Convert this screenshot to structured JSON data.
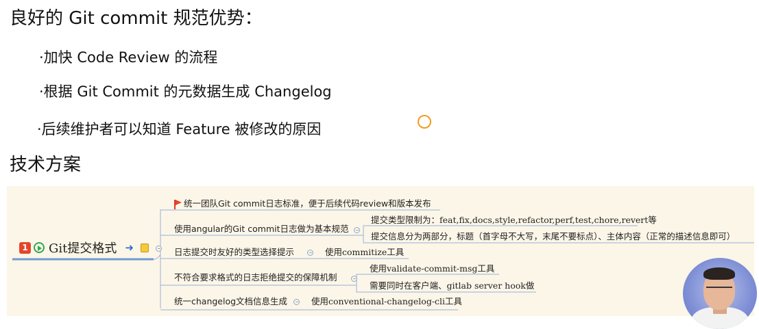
{
  "slide": {
    "heading1": "良好的 Git commit 规范优势：",
    "bullets": [
      "·加快 Code Review 的流程",
      "·根据 Git Commit 的元数据生成 Changelog",
      "·后续维护者可以知道 Feature 被修改的原因"
    ],
    "heading2": "技术方案"
  },
  "mindmap": {
    "root": {
      "badge": "1",
      "label": "Git提交格式"
    },
    "branches": [
      {
        "label": "统一团队Git commit日志标准，便于后续代码review和版本发布",
        "children": []
      },
      {
        "label": "使用angular的Git commit日志做为基本规范",
        "children": [
          "提交类型限制为：feat,fix,docs,style,refactor,perf,test,chore,revert等",
          "提交信息分为两部分，标题（首字母不大写，末尾不要标点）、主体内容（正常的描述信息即可）"
        ]
      },
      {
        "label": "日志提交时友好的类型选择提示",
        "children": [
          "使用commitize工具"
        ]
      },
      {
        "label": "不符合要求格式的日志拒绝提交的保障机制",
        "children": [
          "使用validate-commit-msg工具",
          "需要同时在客户端、gitlab server hook做"
        ]
      },
      {
        "label": "统一changelog文档信息生成",
        "children": [
          "使用conventional-changelog-cli工具"
        ]
      }
    ]
  },
  "icons": {
    "flag": "flag-icon",
    "play": "play-circle-icon",
    "arrow": "link-arrow-icon",
    "note": "note-icon",
    "collapse": "collapse-toggle-icon",
    "cursor": "cursor-ring-icon"
  },
  "colors": {
    "mindmap_bg": "#fcf6e8",
    "branch_line": "#a9bedb",
    "root_underline": "#6f9bd1",
    "flag": "#e5462b",
    "cursor": "#f39b1d"
  }
}
